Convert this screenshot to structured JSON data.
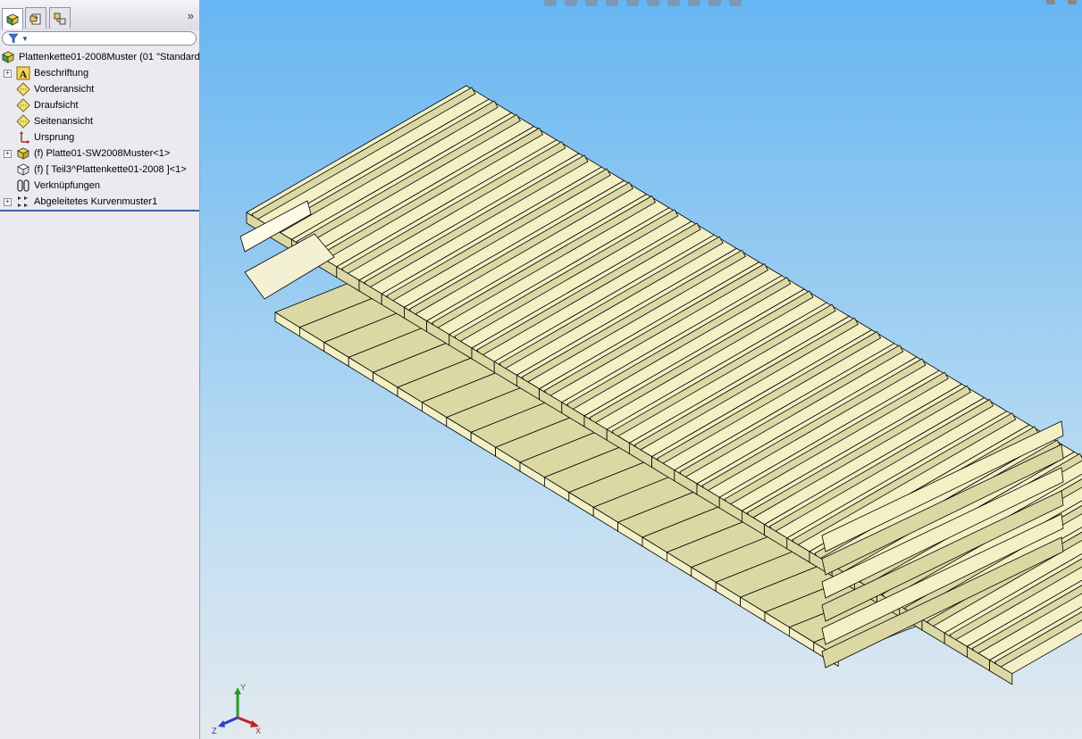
{
  "panel": {
    "tabs": [
      {
        "name": "feature-manager-tab",
        "icon": "feature-tree-icon",
        "active": true
      },
      {
        "name": "property-manager-tab",
        "icon": "property-icon",
        "active": false
      },
      {
        "name": "configuration-manager-tab",
        "icon": "configuration-icon",
        "active": false
      }
    ],
    "expand_icon": "double-chevron-right-icon",
    "filter_icon": "filter-icon"
  },
  "tree": {
    "root": {
      "label": "Plattenkette01-2008Muster  (01 \"Standard\"",
      "icon": "assembly-icon"
    },
    "items": [
      {
        "label": "Beschriftung",
        "icon": "annotation-icon",
        "expandable": true
      },
      {
        "label": "Vorderansicht",
        "icon": "plane-icon",
        "expandable": false
      },
      {
        "label": "Draufsicht",
        "icon": "plane-icon",
        "expandable": false
      },
      {
        "label": "Seitenansicht",
        "icon": "plane-icon",
        "expandable": false
      },
      {
        "label": "Ursprung",
        "icon": "origin-icon",
        "expandable": false
      },
      {
        "label": "(f) Platte01-SW2008Muster<1>",
        "icon": "part-icon",
        "expandable": true
      },
      {
        "label": "(f) [ Teil3^Plattenkette01-2008 ]<1>",
        "icon": "virtual-part-icon",
        "expandable": false
      },
      {
        "label": "Verknüpfungen",
        "icon": "mates-icon",
        "expandable": false
      },
      {
        "label": "Abgeleitetes Kurvenmuster1",
        "icon": "curve-pattern-icon",
        "expandable": true
      }
    ]
  },
  "viewport": {
    "background_top": "#67b6f3",
    "background_bottom": "#e2e9ef",
    "model_color": "#f3f0c6",
    "model_shade": "#dcd8a4",
    "edge_color": "#000000",
    "triad": {
      "x": "X",
      "y": "Y",
      "z": "Z"
    }
  }
}
